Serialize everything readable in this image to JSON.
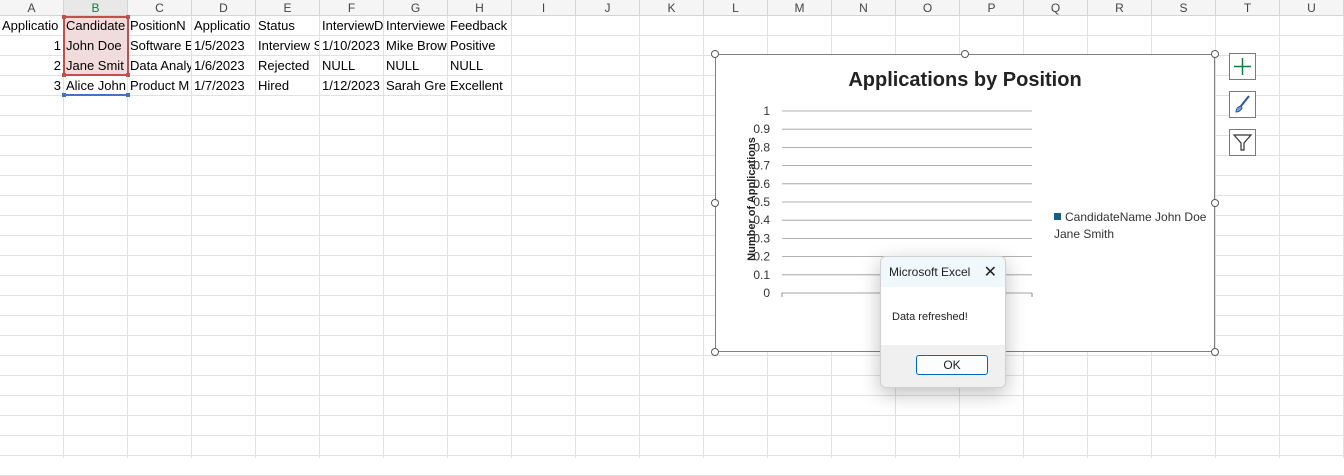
{
  "columns": [
    "A",
    "B",
    "C",
    "D",
    "E",
    "F",
    "G",
    "H",
    "I",
    "J",
    "K",
    "L",
    "M",
    "N",
    "O",
    "P",
    "Q",
    "R",
    "S",
    "T",
    "U"
  ],
  "rows": [
    [
      "Applicatio",
      "Candidate",
      "PositionN",
      "Applicatio",
      "Status",
      "InterviewD",
      "Interviewe",
      "Feedback"
    ],
    [
      "1",
      "John Doe",
      "Software E",
      "1/5/2023",
      "Interview S",
      "1/10/2023",
      "Mike Brow",
      "Positive"
    ],
    [
      "2",
      "Jane Smit",
      "Data Analy",
      "1/6/2023",
      "Rejected",
      "NULL",
      "NULL",
      "NULL"
    ],
    [
      "3",
      "Alice John",
      "Product M",
      "1/7/2023",
      "Hired",
      "1/12/2023",
      "Sarah Gre",
      "Excellent"
    ]
  ],
  "chart": {
    "title": "Applications by Position",
    "ylabel": "Number of Applications",
    "legend_line1": "CandidateName John Doe",
    "legend_line2": "Jane Smith"
  },
  "chart_data": {
    "type": "bar",
    "title": "Applications by Position",
    "ylabel": "Number of Applications",
    "ylim": [
      0,
      1
    ],
    "yticks": [
      "1",
      "0.9",
      "0.8",
      "0.7",
      "0.6",
      "0.5",
      "0.4",
      "0.3",
      "0.2",
      "0.1",
      "0"
    ],
    "series": [
      {
        "name": "CandidateName John Doe Jane Smith",
        "values": []
      }
    ],
    "grid": true,
    "legend": "right",
    "accent": "#156082"
  },
  "dialog": {
    "title": "Microsoft Excel",
    "message": "Data refreshed!",
    "ok_label": "OK",
    "close_symbol": "✕"
  }
}
